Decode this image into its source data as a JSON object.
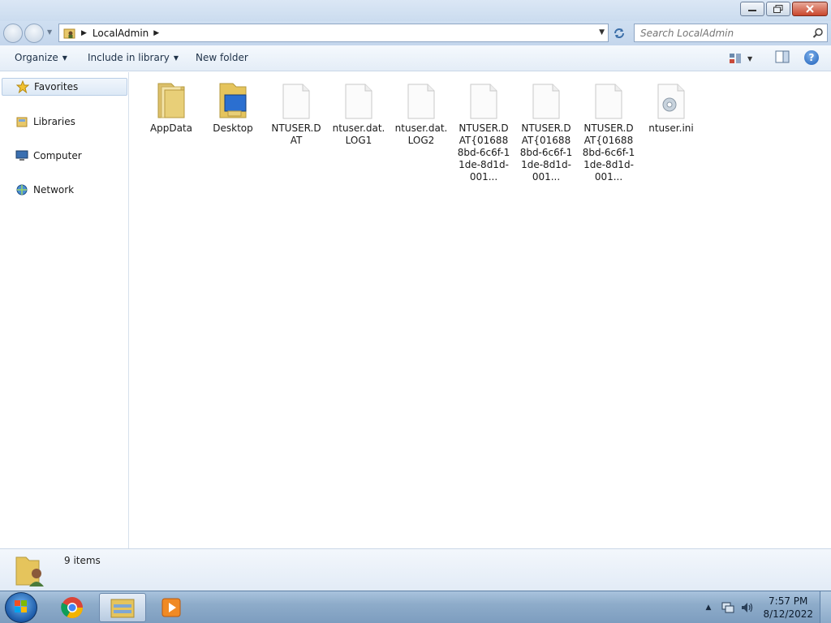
{
  "window": {
    "minimize_icon": "minimize-icon",
    "maximize_icon": "restore-icon",
    "close_icon": "close-icon"
  },
  "address": {
    "crumbs": [
      "LocalAdmin"
    ],
    "search_placeholder": "Search LocalAdmin"
  },
  "toolbar": {
    "organize": "Organize",
    "include": "Include in library",
    "new_folder": "New folder",
    "help": "?"
  },
  "nav": {
    "items": [
      {
        "label": "Favorites",
        "icon": "star-icon"
      },
      {
        "label": "Libraries",
        "icon": "library-icon"
      },
      {
        "label": "Computer",
        "icon": "computer-icon"
      },
      {
        "label": "Network",
        "icon": "network-icon"
      }
    ]
  },
  "files": [
    {
      "name": "AppData",
      "icon": "folder-icon"
    },
    {
      "name": "Desktop",
      "icon": "desktop-folder-icon"
    },
    {
      "name": "NTUSER.DAT",
      "icon": "file-icon"
    },
    {
      "name": "ntuser.dat.LOG1",
      "icon": "file-icon"
    },
    {
      "name": "ntuser.dat.LOG2",
      "icon": "file-icon"
    },
    {
      "name": "NTUSER.DAT{016888bd-6c6f-11de-8d1d-001...",
      "icon": "file-icon"
    },
    {
      "name": "NTUSER.DAT{016888bd-6c6f-11de-8d1d-001...",
      "icon": "file-icon"
    },
    {
      "name": "NTUSER.DAT{016888bd-6c6f-11de-8d1d-001...",
      "icon": "file-icon"
    },
    {
      "name": "ntuser.ini",
      "icon": "settings-file-icon"
    }
  ],
  "details": {
    "count": "9 items"
  },
  "taskbar": {
    "time": "7:57 PM",
    "date": "8/12/2022"
  },
  "colors": {
    "accent": "#3b6ea8",
    "folder": "#e8c86a"
  }
}
